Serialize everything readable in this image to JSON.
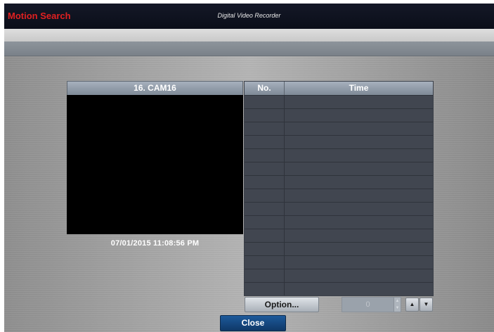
{
  "window": {
    "title": "Motion Search",
    "product": "Digital Video Recorder",
    "title_color": "#e02020"
  },
  "camera": {
    "label": "16. CAM16",
    "timestamp": "07/01/2015  11:08:56 PM"
  },
  "table": {
    "columns": [
      "No.",
      "Time"
    ],
    "rows": [
      {
        "no": "",
        "time": ""
      },
      {
        "no": "",
        "time": ""
      },
      {
        "no": "",
        "time": ""
      },
      {
        "no": "",
        "time": ""
      },
      {
        "no": "",
        "time": ""
      },
      {
        "no": "",
        "time": ""
      },
      {
        "no": "",
        "time": ""
      },
      {
        "no": "",
        "time": ""
      },
      {
        "no": "",
        "time": ""
      },
      {
        "no": "",
        "time": ""
      },
      {
        "no": "",
        "time": ""
      },
      {
        "no": "",
        "time": ""
      },
      {
        "no": "",
        "time": ""
      },
      {
        "no": "",
        "time": ""
      },
      {
        "no": "",
        "time": ""
      }
    ]
  },
  "controls": {
    "option_label": "Option...",
    "page_value": "0",
    "page_up_icon": "up-triangle-icon",
    "page_down_icon": "down-triangle-icon",
    "close_label": "Close",
    "close_color": "#1d5a9b"
  }
}
